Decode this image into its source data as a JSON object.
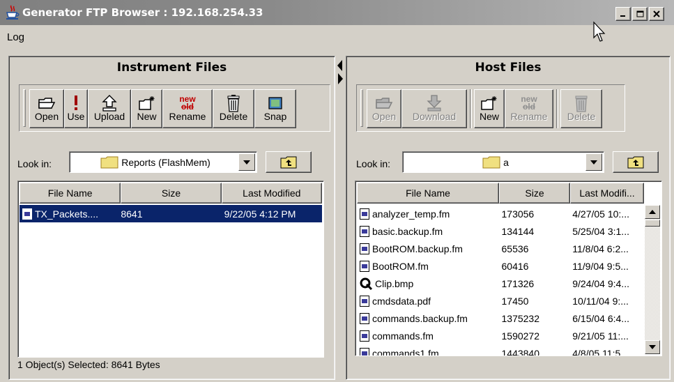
{
  "window": {
    "title": "Generator FTP Browser : 192.168.254.33"
  },
  "menu": {
    "items": [
      "Log"
    ]
  },
  "left": {
    "title": "Instrument Files",
    "toolbar": {
      "open": "Open",
      "use": "Use",
      "upload": "Upload",
      "new": "New",
      "rename": "Rename",
      "delete": "Delete",
      "snap": "Snap",
      "rename_icon_top": "new",
      "rename_icon_bottom": "old"
    },
    "look_in_label": "Look in:",
    "look_in_value": "Reports   (FlashMem)",
    "columns": [
      "File Name",
      "Size",
      "Last Modified"
    ],
    "rows": [
      {
        "name": "TX_Packets....",
        "size": "8641",
        "modified": "9/22/05 4:12 PM",
        "selected": true
      }
    ],
    "status": "1 Object(s) Selected:  8641 Bytes"
  },
  "right": {
    "title": "Host Files",
    "toolbar": {
      "open": "Open",
      "download": "Download",
      "new": "New",
      "rename": "Rename",
      "delete": "Delete",
      "rename_icon_top": "new",
      "rename_icon_bottom": "old"
    },
    "look_in_label": "Look in:",
    "look_in_value": "a",
    "columns": [
      "File Name",
      "Size",
      "Last Modifi..."
    ],
    "rows": [
      {
        "name": "analyzer_temp.fm",
        "size": "173056",
        "modified": "4/27/05 10:...",
        "icon": "doc-icon"
      },
      {
        "name": "basic.backup.fm",
        "size": "134144",
        "modified": "5/25/04 3:1...",
        "icon": "doc-icon"
      },
      {
        "name": "BootROM.backup.fm",
        "size": "65536",
        "modified": "11/8/04 6:2...",
        "icon": "doc-icon"
      },
      {
        "name": "BootROM.fm",
        "size": "60416",
        "modified": "11/9/04 9:5...",
        "icon": "doc-icon"
      },
      {
        "name": "Clip.bmp",
        "size": "171326",
        "modified": "9/24/04 9:4...",
        "icon": "bmp-icon"
      },
      {
        "name": "cmdsdata.pdf",
        "size": "17450",
        "modified": "10/11/04 9:...",
        "icon": "doc-icon"
      },
      {
        "name": "commands.backup.fm",
        "size": "1375232",
        "modified": "6/15/04 6:4...",
        "icon": "doc-icon"
      },
      {
        "name": "commands.fm",
        "size": "1590272",
        "modified": "9/21/05 11:...",
        "icon": "doc-icon"
      },
      {
        "name": "commands1.fm",
        "size": "1443840",
        "modified": "4/8/05 11:5...",
        "icon": "doc-icon"
      }
    ]
  },
  "colors": {
    "selection": "#0a246a",
    "chrome": "#d4d0c8",
    "titlebar": "#808080"
  }
}
